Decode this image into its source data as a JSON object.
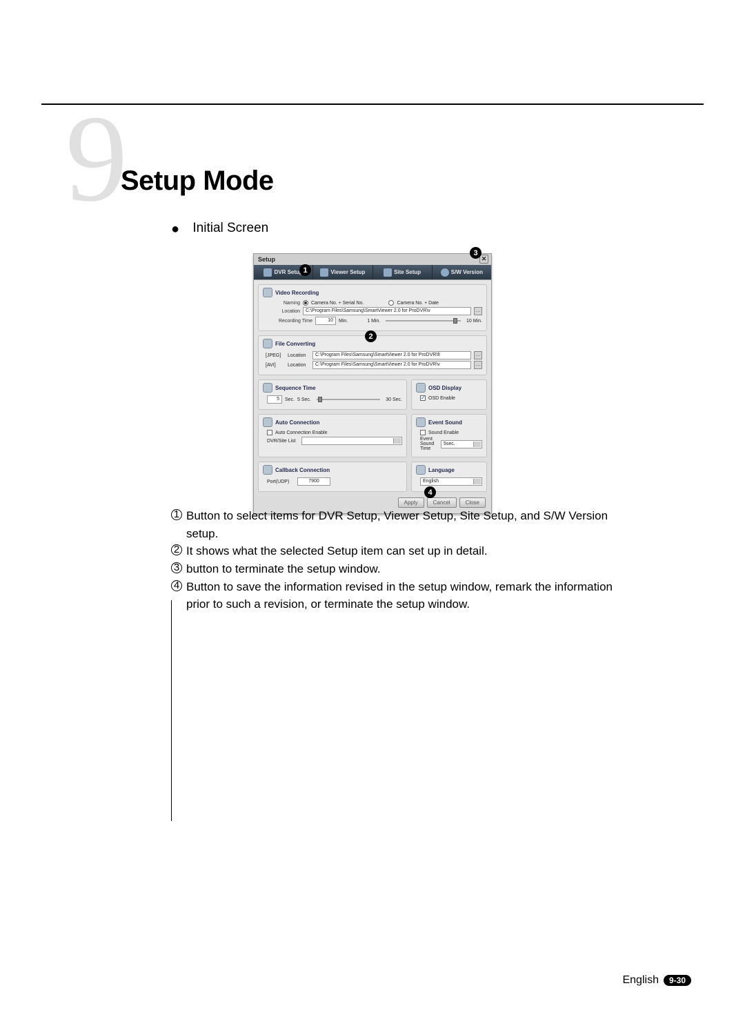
{
  "chapter": {
    "number": "9",
    "title": "Setup Mode"
  },
  "section_label": "Initial Screen",
  "badges": {
    "b1": "1",
    "b2": "2",
    "b3": "3",
    "b4": "4"
  },
  "setup": {
    "window_title": "Setup",
    "tabs": {
      "dvr": "DVR Setup",
      "viewer": "Viewer Setup",
      "site": "Site Setup",
      "sw": "S/W Version"
    },
    "video_rec": {
      "title": "Video Recording",
      "naming_lbl": "Naming",
      "naming_opt1": "Camera No. + Serial No.",
      "naming_opt2": "Camera No. + Date",
      "location_lbl": "Location",
      "location_val": "C:\\Program Files\\Samsung\\SmartViewer 2.0 for ProDVR\\v",
      "rectime_lbl": "Recording Time",
      "rectime_val": "10",
      "rectime_unit": "Min.",
      "rectime_min": "1 Min.",
      "rectime_max": "10 Min."
    },
    "file_conv": {
      "title": "File Converting",
      "jpeg_lbl": "[JPEG]",
      "avi_lbl": "[AVI]",
      "loc_lbl": "Location",
      "path1": "C:\\Program Files\\Samsung\\SmartViewer 2.0 for ProDVR\\fi",
      "path2": "C:\\Program Files\\Samsung\\SmartViewer 2.0 for ProDVR\\v"
    },
    "seq_time": {
      "title": "Sequence Time",
      "val": "5",
      "unit": "Sec.",
      "min": "5 Sec.",
      "max": "30 Sec."
    },
    "osd": {
      "title": "OSD Display",
      "chk": "OSD Enable"
    },
    "auto": {
      "title": "Auto Connection",
      "chk": "Auto Connection Enable",
      "list_lbl": "DVR/Site List"
    },
    "event": {
      "title": "Event Sound",
      "chk": "Sound Enable",
      "time_lbl": "Event Sound Time",
      "time_val": "5sec."
    },
    "callback": {
      "title": "Callback Connection",
      "port_lbl": "Port(UDP)",
      "port_val": "7900"
    },
    "lang": {
      "title": "Language",
      "val": "English"
    },
    "buttons": {
      "apply": "Apply",
      "cancel": "Cancel",
      "close": "Close"
    }
  },
  "notes": {
    "n1a": "Button to select items for DVR Setup, Viewer Setup, Site Setup, and S/W Version",
    "n1b": "setup.",
    "n2": "It shows what the selected Setup item can set up in detail.",
    "n3": "button to terminate the setup window.",
    "n4a": "Button to save the information revised in the setup window, remark the information",
    "n4b": "prior to such a revision, or terminate the setup window."
  },
  "footer": {
    "lang": "English",
    "page": "9-30"
  }
}
